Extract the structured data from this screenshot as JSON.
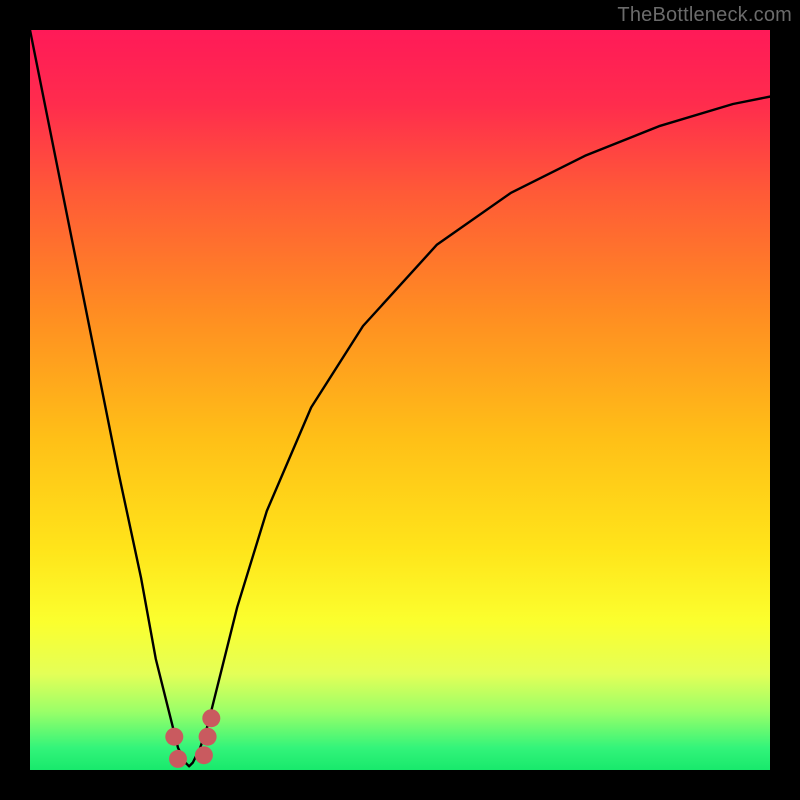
{
  "watermark": {
    "text": "TheBottleneck.com"
  },
  "chart_data": {
    "type": "line",
    "title": "",
    "xlabel": "",
    "ylabel": "",
    "xlim": [
      0,
      100
    ],
    "ylim": [
      0,
      100
    ],
    "grid": false,
    "legend": false,
    "series": [
      {
        "name": "bottleneck-curve",
        "x": [
          0,
          3,
          6,
          9,
          12,
          15,
          17,
          19,
          20,
          21,
          21.5,
          22,
          23,
          24,
          25,
          26,
          28,
          32,
          38,
          45,
          55,
          65,
          75,
          85,
          95,
          100
        ],
        "values": [
          100,
          85,
          70,
          55,
          40,
          26,
          15,
          7,
          3,
          1,
          0.5,
          1,
          3,
          6,
          10,
          14,
          22,
          35,
          49,
          60,
          71,
          78,
          83,
          87,
          90,
          91
        ],
        "note": "V-shaped curve; minimum (~0% bottleneck) near x≈21.5; left branch climbs to 100 at x=0; right branch asymptotes ~91 at x=100"
      },
      {
        "name": "optimal-marker-dots",
        "x": [
          19.5,
          20.0,
          23.5,
          24.0,
          24.5
        ],
        "values": [
          4.5,
          1.5,
          2.0,
          4.5,
          7.0
        ]
      }
    ],
    "background_gradient_stops": [
      {
        "t": 0.0,
        "c": "#ff1a58"
      },
      {
        "t": 0.1,
        "c": "#ff2c4d"
      },
      {
        "t": 0.22,
        "c": "#ff5a37"
      },
      {
        "t": 0.38,
        "c": "#ff8c22"
      },
      {
        "t": 0.55,
        "c": "#ffbf17"
      },
      {
        "t": 0.7,
        "c": "#ffe41a"
      },
      {
        "t": 0.8,
        "c": "#fbff2e"
      },
      {
        "t": 0.87,
        "c": "#e4ff57"
      },
      {
        "t": 0.92,
        "c": "#9cff68"
      },
      {
        "t": 0.97,
        "c": "#33f47a"
      },
      {
        "t": 1.0,
        "c": "#18e96c"
      }
    ],
    "marker_color": "#c95a5f",
    "curve_color": "#000000"
  }
}
